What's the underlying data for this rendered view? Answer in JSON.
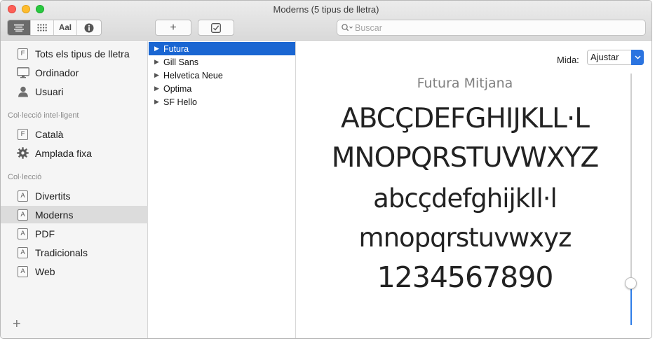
{
  "window": {
    "title": "Moderns (5 tipus de lletra)"
  },
  "toolbar": {
    "view_buttons": [
      {
        "name": "list-view",
        "icon": "list-lines-icon"
      },
      {
        "name": "grid-view",
        "icon": "grid-dots-icon"
      },
      {
        "name": "sample-view",
        "label": "AaI"
      },
      {
        "name": "info-view",
        "icon": "info-icon"
      }
    ],
    "add_label": "+",
    "check_icon": "checkbox-icon",
    "search": {
      "placeholder": "Buscar",
      "value": ""
    }
  },
  "sidebar": {
    "library": [
      {
        "label": "Tots els tipus de lletra",
        "icon": "font-box-icon"
      },
      {
        "label": "Ordinador",
        "icon": "computer-icon"
      },
      {
        "label": "Usuari",
        "icon": "user-icon"
      }
    ],
    "smart_heading": "Col·lecció intel·ligent",
    "smart": [
      {
        "label": "Català",
        "icon": "font-box-icon"
      },
      {
        "label": "Amplada fixa",
        "icon": "gear-icon"
      }
    ],
    "collection_heading": "Col·lecció",
    "collections": [
      {
        "label": "Divertits",
        "icon": "collection-icon"
      },
      {
        "label": "Moderns",
        "icon": "collection-icon",
        "selected": true
      },
      {
        "label": "PDF",
        "icon": "collection-icon"
      },
      {
        "label": "Tradicionals",
        "icon": "collection-icon"
      },
      {
        "label": "Web",
        "icon": "collection-icon"
      }
    ],
    "add_label": "+"
  },
  "font_list": [
    {
      "label": "Futura",
      "selected": true
    },
    {
      "label": "Gill Sans"
    },
    {
      "label": "Helvetica Neue"
    },
    {
      "label": "Optima"
    },
    {
      "label": "SF Hello"
    }
  ],
  "preview": {
    "size_label": "Mida:",
    "size_value": "Ajustar",
    "font_name": "Futura Mitjana",
    "lines": [
      "ABCÇDEFGHIJKLL·L",
      "MNOPQRSTUVWXYZ",
      "abcçdefghijkll·l",
      "mnopqrstuvwxyz",
      "1234567890"
    ],
    "slider_level": 0.165
  },
  "colors": {
    "selection_blue": "#1a66d2",
    "accent": "#2b74e0",
    "sidebar_bg": "#f5f5f5"
  }
}
